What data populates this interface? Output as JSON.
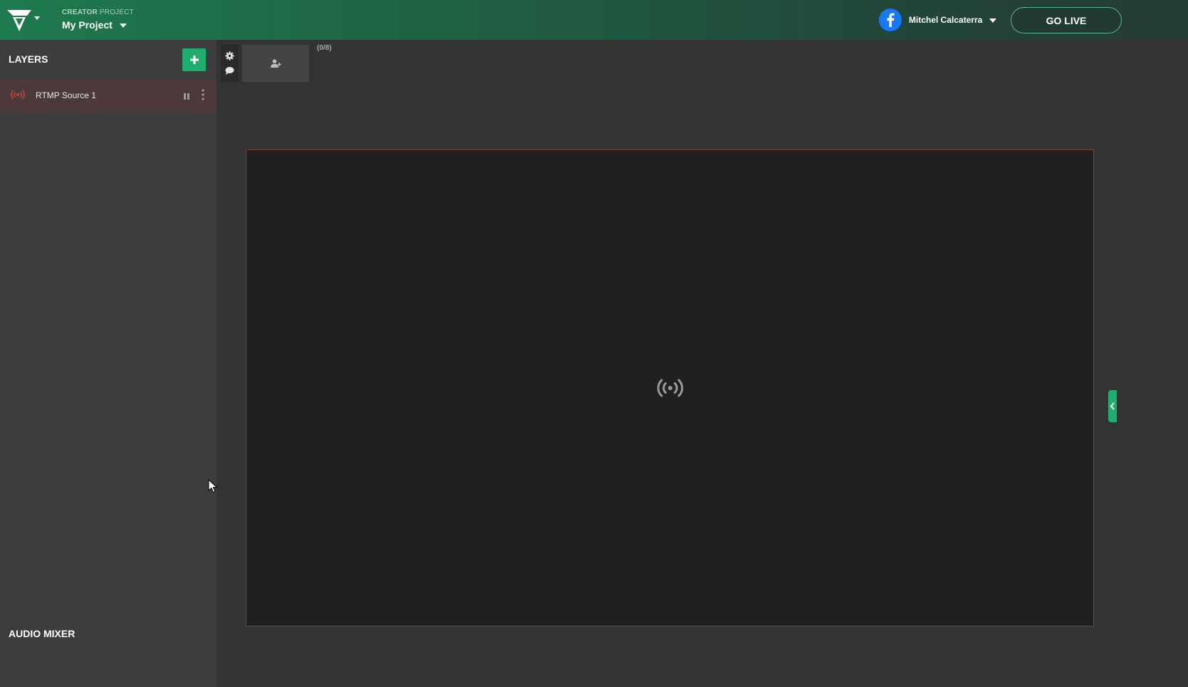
{
  "header": {
    "project_label_bold": "CREATOR",
    "project_label_rest": " PROJECT",
    "project_name": "My Project",
    "account_name": "Mitchel Calcaterra",
    "go_live_label": "GO LIVE"
  },
  "sidebar": {
    "layers_title": "LAYERS",
    "layers": [
      {
        "name": "RTMP Source 1",
        "icon": "broadcast-icon"
      }
    ],
    "audio_mixer_title": "AUDIO MIXER"
  },
  "main": {
    "guest_count": "(0/8)",
    "canvas_icon": "broadcast-icon"
  },
  "colors": {
    "accent_green": "#1fae6e",
    "facebook_blue": "#1877f2",
    "rtmp_red": "#c0443f"
  }
}
